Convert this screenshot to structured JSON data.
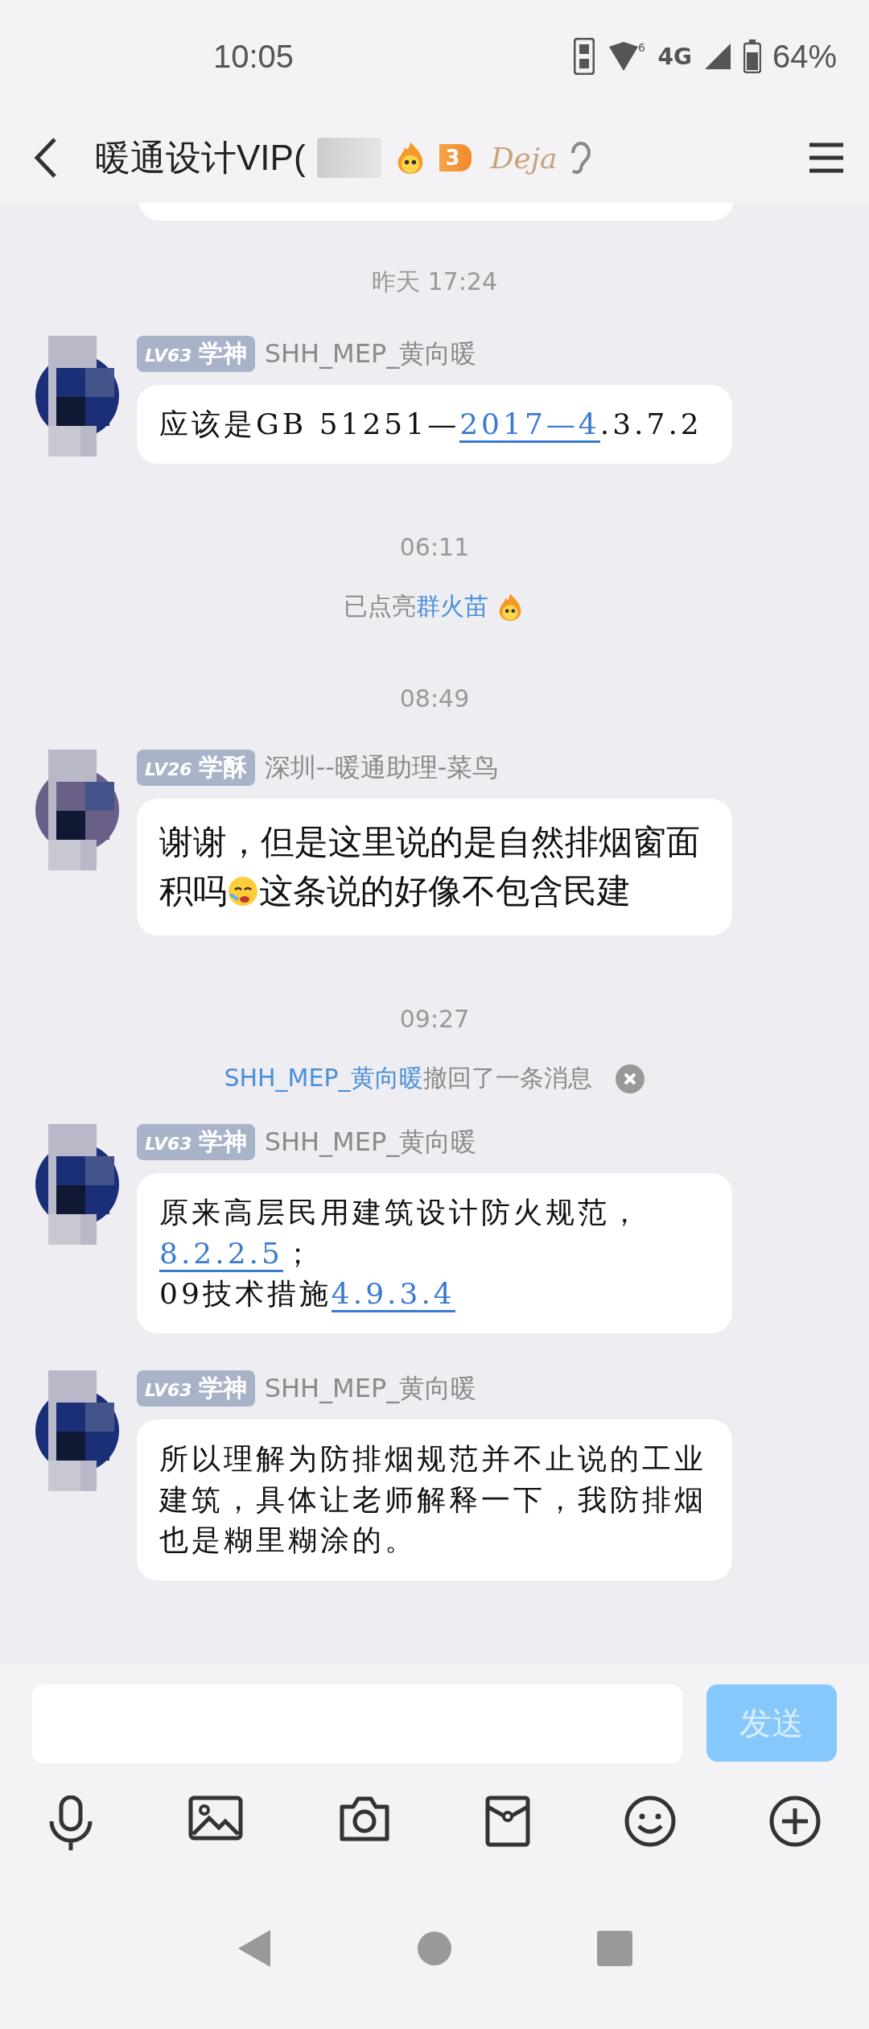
{
  "status_bar": {
    "time": "10:05",
    "network": "4G",
    "wifi_badge": "6",
    "battery": "64%"
  },
  "header": {
    "title": "暖通设计VIP(",
    "flame_count": "3",
    "brand": "Deja"
  },
  "items": [
    {
      "kind": "partial_bubble"
    },
    {
      "kind": "time",
      "text": "昨天 17:24"
    },
    {
      "kind": "message",
      "badge": {
        "level": "LV63",
        "title": "学神"
      },
      "sender": "SHH_MEP_黄向暖",
      "script": true,
      "segments": [
        {
          "kind": "text",
          "text": "应该是GB 51251—"
        },
        {
          "kind": "link",
          "text": "2017—4"
        },
        {
          "kind": "text",
          "text": ".3.7.2"
        }
      ]
    },
    {
      "kind": "time",
      "text": "06:11"
    },
    {
      "kind": "notice",
      "parts": [
        {
          "kind": "text",
          "text": "已点亮"
        },
        {
          "kind": "link",
          "text": "群火苗"
        }
      ],
      "flame": true,
      "dismiss": false
    },
    {
      "kind": "time",
      "text": "08:49"
    },
    {
      "kind": "message",
      "badge": {
        "level": "LV26",
        "title": "学酥"
      },
      "sender": "深圳--暖通助理-菜鸟",
      "script": false,
      "segments": [
        {
          "kind": "text",
          "text": "谢谢，但是这里说的是自然排烟窗面积吗"
        },
        {
          "kind": "emoji"
        },
        {
          "kind": "text",
          "text": "这条说的好像不包含民建"
        }
      ]
    },
    {
      "kind": "time",
      "text": "09:27"
    },
    {
      "kind": "notice",
      "parts": [
        {
          "kind": "link",
          "text": "SHH_MEP_黄向暖"
        },
        {
          "kind": "text",
          "text": "撤回了一条消息"
        }
      ],
      "flame": false,
      "dismiss": true
    },
    {
      "kind": "message",
      "badge": {
        "level": "LV63",
        "title": "学神"
      },
      "sender": "SHH_MEP_黄向暖",
      "script": true,
      "segments": [
        {
          "kind": "text",
          "text": "原来高层民用建筑设计防火规范，"
        },
        {
          "kind": "break"
        },
        {
          "kind": "link",
          "text": "8.2.2.5"
        },
        {
          "kind": "text",
          "text": "；"
        },
        {
          "kind": "break"
        },
        {
          "kind": "text",
          "text": "09技术措施"
        },
        {
          "kind": "link",
          "text": "4.9.3.4"
        }
      ]
    },
    {
      "kind": "message",
      "badge": {
        "level": "LV63",
        "title": "学神"
      },
      "sender": "SHH_MEP_黄向暖",
      "script": true,
      "segments": [
        {
          "kind": "text",
          "text": "所以理解为防排烟规范并不止说的工业建筑，具体让老师解释一下，我防排烟也是糊里糊涂的。"
        }
      ]
    }
  ],
  "composer": {
    "send": "发送",
    "send_disabled": true
  }
}
